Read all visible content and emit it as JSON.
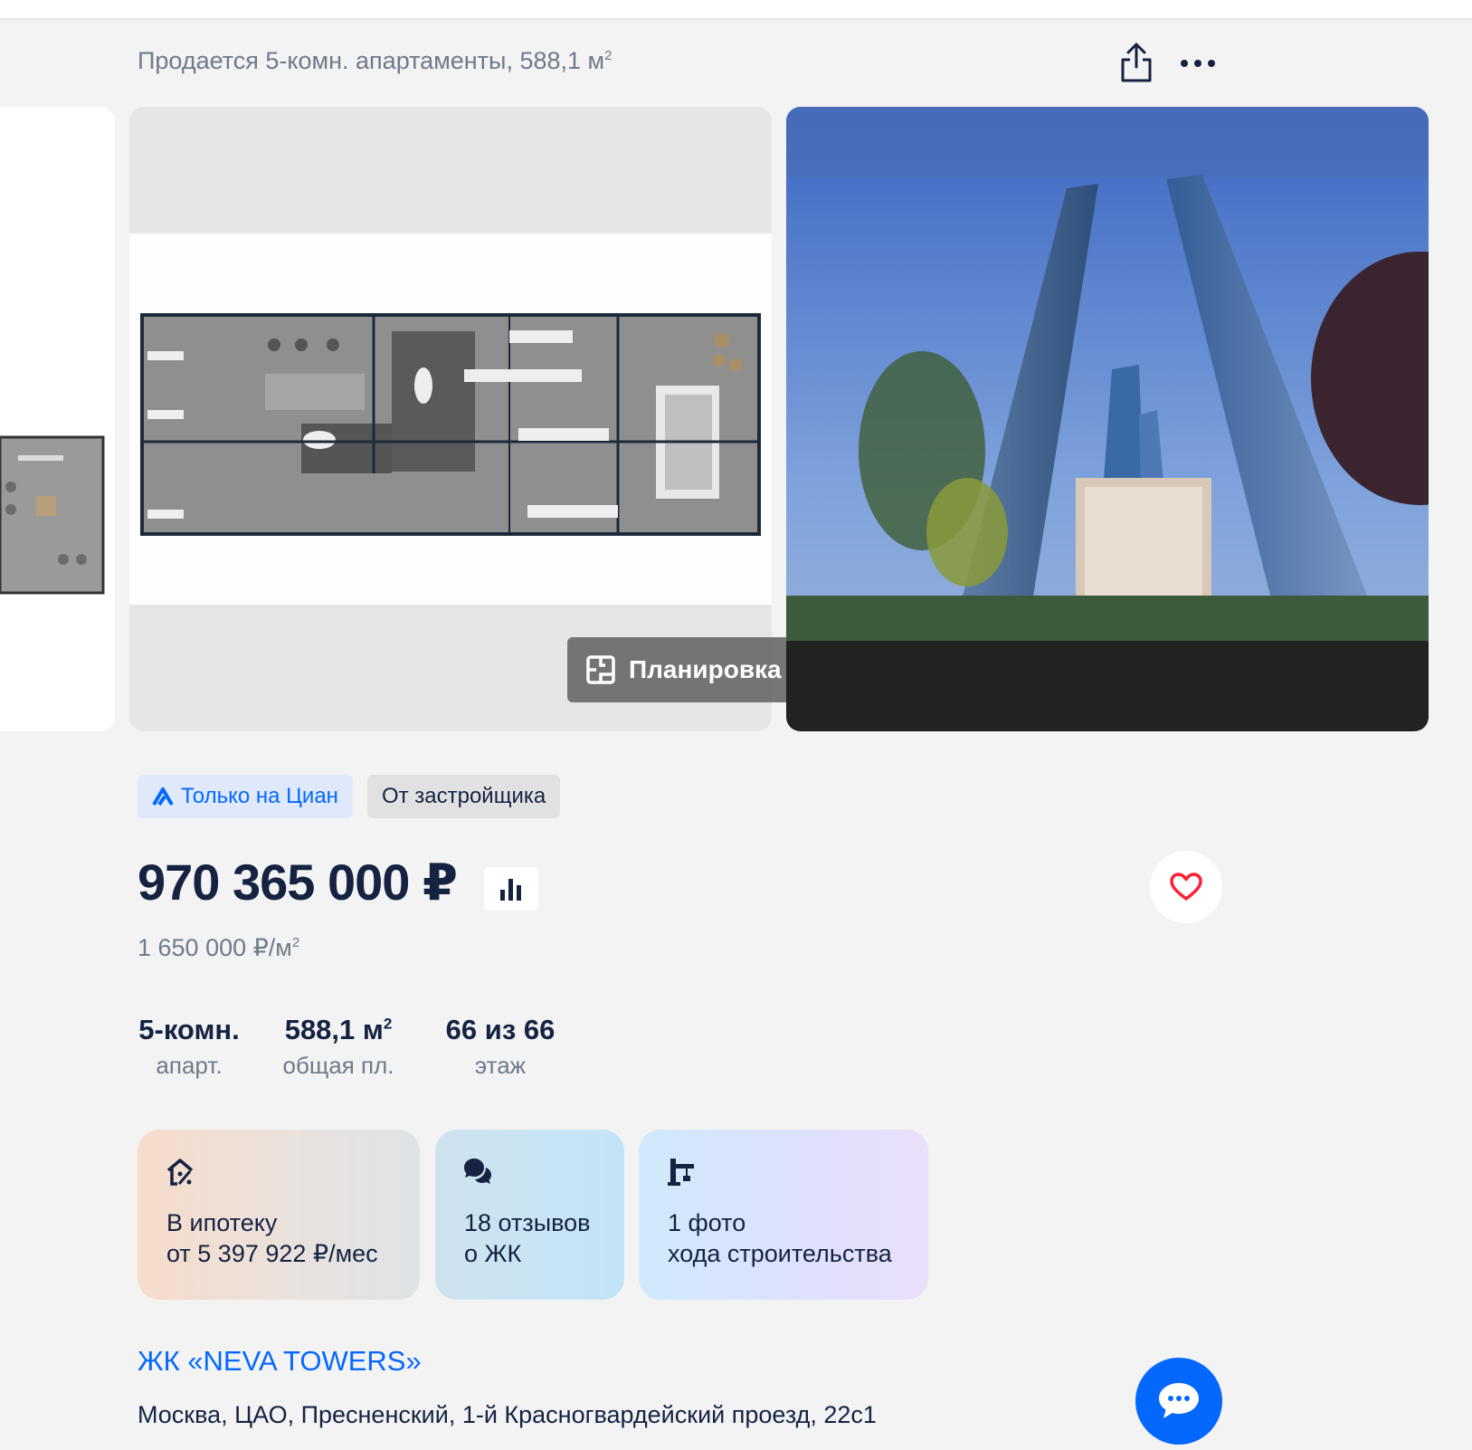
{
  "header": {
    "title": "Продается 5-комн. апартаменты, 588,1 м",
    "title_sup": "2"
  },
  "gallery": {
    "plan_button_label": "Планировка"
  },
  "badges": {
    "cian_only": "Только на Циан",
    "developer": "От застройщика"
  },
  "price": {
    "total": "970 365 000 ₽",
    "per_meter": "1 650 000 ₽/м",
    "per_meter_sup": "2"
  },
  "features": [
    {
      "value": "5-комн.",
      "label": "апарт."
    },
    {
      "value": "588,1 м",
      "value_sup": "2",
      "label": "общая пл."
    },
    {
      "value": "66 из 66",
      "label": "этаж"
    }
  ],
  "promos": [
    {
      "line1": "В ипотеку",
      "line2": "от 5 397 922 ₽/мес",
      "icon": "house-percent-icon"
    },
    {
      "line1": "18 отзывов",
      "line2": "о ЖК",
      "icon": "chat-bubbles-icon"
    },
    {
      "line1": "1 фото",
      "line2": "хода строительства",
      "icon": "crane-icon"
    }
  ],
  "complex": {
    "name": "ЖК «NEVA TOWERS»",
    "address": "Москва, ЦАО, Пресненский, 1-й Красногвардейский проезд, 22с1"
  },
  "colors": {
    "accent": "#0468ff",
    "text": "#152242",
    "muted": "#707a89",
    "heart": "#ff1f34"
  }
}
